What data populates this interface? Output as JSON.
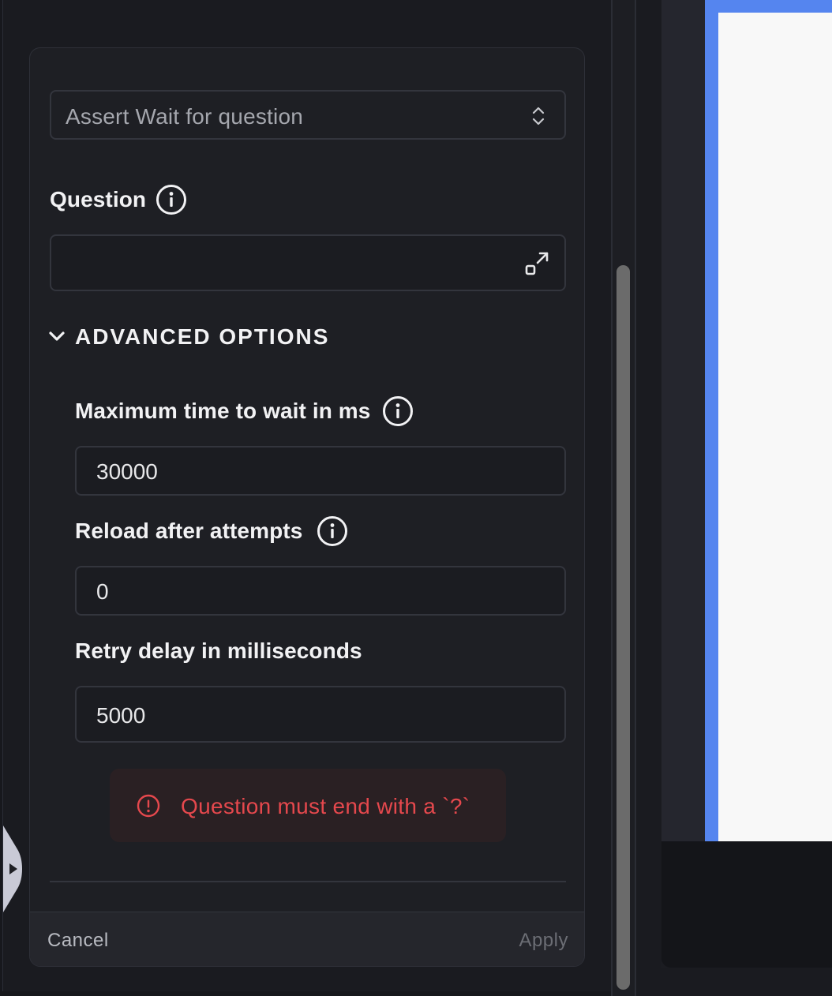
{
  "select": {
    "value": "Assert Wait for question",
    "chevron_icon": "up-down-chevron-icon"
  },
  "question": {
    "label": "Question",
    "value": "",
    "info_icon": "info-icon",
    "expand_icon": "expand-icon"
  },
  "advanced": {
    "title": "ADVANCED OPTIONS",
    "expanded": true,
    "fields": [
      {
        "label": "Maximum time to wait in ms",
        "value": "30000",
        "has_info": true
      },
      {
        "label": "Reload after attempts",
        "value": "0",
        "has_info": true
      },
      {
        "label": "Retry delay in milliseconds",
        "value": "5000",
        "has_info": false
      }
    ]
  },
  "error": {
    "message": "Question must end with a `?`",
    "color": "#e5484d"
  },
  "footer": {
    "cancel_label": "Cancel",
    "apply_label": "Apply",
    "apply_enabled": false
  },
  "colors": {
    "panel": "#1e1f24",
    "accent_blue": "#5585ef",
    "error_bg": "#2a2023"
  }
}
